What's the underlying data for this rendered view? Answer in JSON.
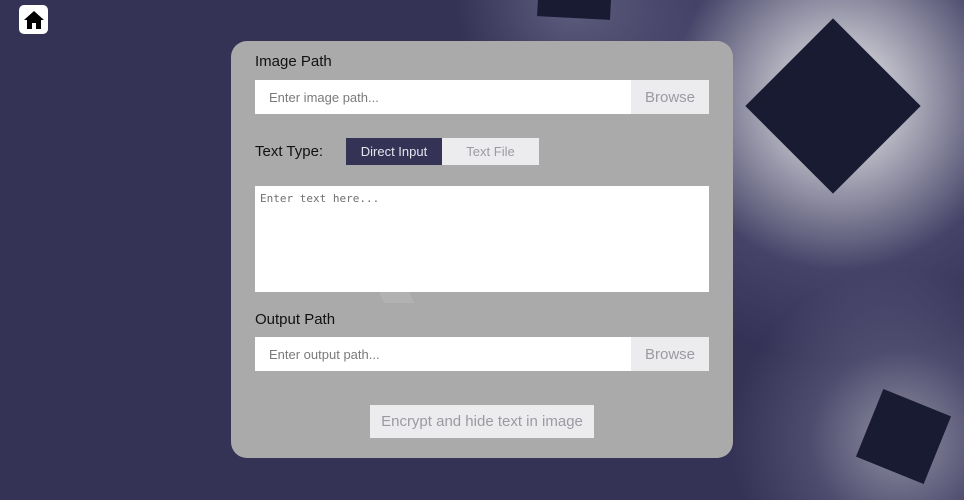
{
  "app": {
    "home_icon": "home-icon"
  },
  "form": {
    "image_path": {
      "label": "Image Path",
      "placeholder": "Enter image path...",
      "value": "",
      "browse_label": "Browse"
    },
    "text_type": {
      "label": "Text Type:",
      "options": [
        "Direct Input",
        "Text File"
      ],
      "selected": "Direct Input"
    },
    "text_area": {
      "placeholder": "Enter text here...",
      "value": ""
    },
    "output_path": {
      "label": "Output Path",
      "placeholder": "Enter output path...",
      "value": "",
      "browse_label": "Browse"
    },
    "submit_label": "Encrypt and hide text in image"
  },
  "colors": {
    "background": "#343255",
    "card": "#abaaaa",
    "accent": "#343255",
    "button": "#ececef",
    "button_text": "#9a9aa2",
    "shape": "#191b33"
  }
}
